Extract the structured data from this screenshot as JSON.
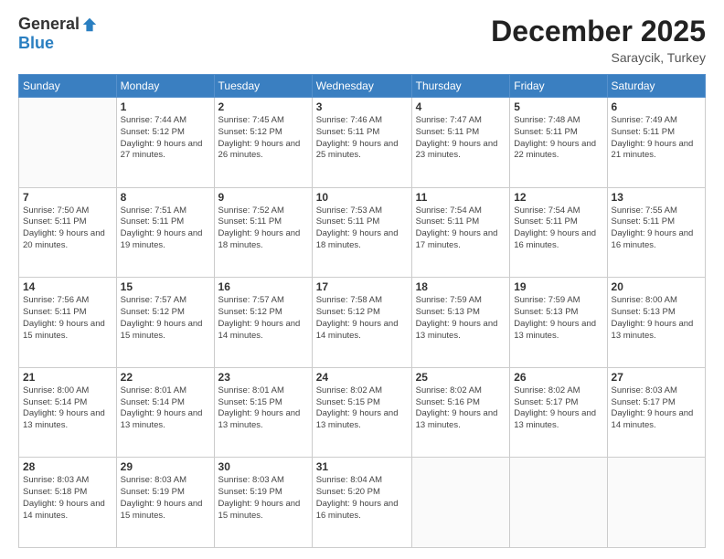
{
  "header": {
    "logo_general": "General",
    "logo_blue": "Blue",
    "month_title": "December 2025",
    "location": "Saraycik, Turkey"
  },
  "weekdays": [
    "Sunday",
    "Monday",
    "Tuesday",
    "Wednesday",
    "Thursday",
    "Friday",
    "Saturday"
  ],
  "weeks": [
    [
      {
        "day": "",
        "sunrise": "",
        "sunset": "",
        "daylight": ""
      },
      {
        "day": "1",
        "sunrise": "Sunrise: 7:44 AM",
        "sunset": "Sunset: 5:12 PM",
        "daylight": "Daylight: 9 hours and 27 minutes."
      },
      {
        "day": "2",
        "sunrise": "Sunrise: 7:45 AM",
        "sunset": "Sunset: 5:12 PM",
        "daylight": "Daylight: 9 hours and 26 minutes."
      },
      {
        "day": "3",
        "sunrise": "Sunrise: 7:46 AM",
        "sunset": "Sunset: 5:11 PM",
        "daylight": "Daylight: 9 hours and 25 minutes."
      },
      {
        "day": "4",
        "sunrise": "Sunrise: 7:47 AM",
        "sunset": "Sunset: 5:11 PM",
        "daylight": "Daylight: 9 hours and 23 minutes."
      },
      {
        "day": "5",
        "sunrise": "Sunrise: 7:48 AM",
        "sunset": "Sunset: 5:11 PM",
        "daylight": "Daylight: 9 hours and 22 minutes."
      },
      {
        "day": "6",
        "sunrise": "Sunrise: 7:49 AM",
        "sunset": "Sunset: 5:11 PM",
        "daylight": "Daylight: 9 hours and 21 minutes."
      }
    ],
    [
      {
        "day": "7",
        "sunrise": "Sunrise: 7:50 AM",
        "sunset": "Sunset: 5:11 PM",
        "daylight": "Daylight: 9 hours and 20 minutes."
      },
      {
        "day": "8",
        "sunrise": "Sunrise: 7:51 AM",
        "sunset": "Sunset: 5:11 PM",
        "daylight": "Daylight: 9 hours and 19 minutes."
      },
      {
        "day": "9",
        "sunrise": "Sunrise: 7:52 AM",
        "sunset": "Sunset: 5:11 PM",
        "daylight": "Daylight: 9 hours and 18 minutes."
      },
      {
        "day": "10",
        "sunrise": "Sunrise: 7:53 AM",
        "sunset": "Sunset: 5:11 PM",
        "daylight": "Daylight: 9 hours and 18 minutes."
      },
      {
        "day": "11",
        "sunrise": "Sunrise: 7:54 AM",
        "sunset": "Sunset: 5:11 PM",
        "daylight": "Daylight: 9 hours and 17 minutes."
      },
      {
        "day": "12",
        "sunrise": "Sunrise: 7:54 AM",
        "sunset": "Sunset: 5:11 PM",
        "daylight": "Daylight: 9 hours and 16 minutes."
      },
      {
        "day": "13",
        "sunrise": "Sunrise: 7:55 AM",
        "sunset": "Sunset: 5:11 PM",
        "daylight": "Daylight: 9 hours and 16 minutes."
      }
    ],
    [
      {
        "day": "14",
        "sunrise": "Sunrise: 7:56 AM",
        "sunset": "Sunset: 5:11 PM",
        "daylight": "Daylight: 9 hours and 15 minutes."
      },
      {
        "day": "15",
        "sunrise": "Sunrise: 7:57 AM",
        "sunset": "Sunset: 5:12 PM",
        "daylight": "Daylight: 9 hours and 15 minutes."
      },
      {
        "day": "16",
        "sunrise": "Sunrise: 7:57 AM",
        "sunset": "Sunset: 5:12 PM",
        "daylight": "Daylight: 9 hours and 14 minutes."
      },
      {
        "day": "17",
        "sunrise": "Sunrise: 7:58 AM",
        "sunset": "Sunset: 5:12 PM",
        "daylight": "Daylight: 9 hours and 14 minutes."
      },
      {
        "day": "18",
        "sunrise": "Sunrise: 7:59 AM",
        "sunset": "Sunset: 5:13 PM",
        "daylight": "Daylight: 9 hours and 13 minutes."
      },
      {
        "day": "19",
        "sunrise": "Sunrise: 7:59 AM",
        "sunset": "Sunset: 5:13 PM",
        "daylight": "Daylight: 9 hours and 13 minutes."
      },
      {
        "day": "20",
        "sunrise": "Sunrise: 8:00 AM",
        "sunset": "Sunset: 5:13 PM",
        "daylight": "Daylight: 9 hours and 13 minutes."
      }
    ],
    [
      {
        "day": "21",
        "sunrise": "Sunrise: 8:00 AM",
        "sunset": "Sunset: 5:14 PM",
        "daylight": "Daylight: 9 hours and 13 minutes."
      },
      {
        "day": "22",
        "sunrise": "Sunrise: 8:01 AM",
        "sunset": "Sunset: 5:14 PM",
        "daylight": "Daylight: 9 hours and 13 minutes."
      },
      {
        "day": "23",
        "sunrise": "Sunrise: 8:01 AM",
        "sunset": "Sunset: 5:15 PM",
        "daylight": "Daylight: 9 hours and 13 minutes."
      },
      {
        "day": "24",
        "sunrise": "Sunrise: 8:02 AM",
        "sunset": "Sunset: 5:15 PM",
        "daylight": "Daylight: 9 hours and 13 minutes."
      },
      {
        "day": "25",
        "sunrise": "Sunrise: 8:02 AM",
        "sunset": "Sunset: 5:16 PM",
        "daylight": "Daylight: 9 hours and 13 minutes."
      },
      {
        "day": "26",
        "sunrise": "Sunrise: 8:02 AM",
        "sunset": "Sunset: 5:17 PM",
        "daylight": "Daylight: 9 hours and 13 minutes."
      },
      {
        "day": "27",
        "sunrise": "Sunrise: 8:03 AM",
        "sunset": "Sunset: 5:17 PM",
        "daylight": "Daylight: 9 hours and 14 minutes."
      }
    ],
    [
      {
        "day": "28",
        "sunrise": "Sunrise: 8:03 AM",
        "sunset": "Sunset: 5:18 PM",
        "daylight": "Daylight: 9 hours and 14 minutes."
      },
      {
        "day": "29",
        "sunrise": "Sunrise: 8:03 AM",
        "sunset": "Sunset: 5:19 PM",
        "daylight": "Daylight: 9 hours and 15 minutes."
      },
      {
        "day": "30",
        "sunrise": "Sunrise: 8:03 AM",
        "sunset": "Sunset: 5:19 PM",
        "daylight": "Daylight: 9 hours and 15 minutes."
      },
      {
        "day": "31",
        "sunrise": "Sunrise: 8:04 AM",
        "sunset": "Sunset: 5:20 PM",
        "daylight": "Daylight: 9 hours and 16 minutes."
      },
      {
        "day": "",
        "sunrise": "",
        "sunset": "",
        "daylight": ""
      },
      {
        "day": "",
        "sunrise": "",
        "sunset": "",
        "daylight": ""
      },
      {
        "day": "",
        "sunrise": "",
        "sunset": "",
        "daylight": ""
      }
    ]
  ]
}
